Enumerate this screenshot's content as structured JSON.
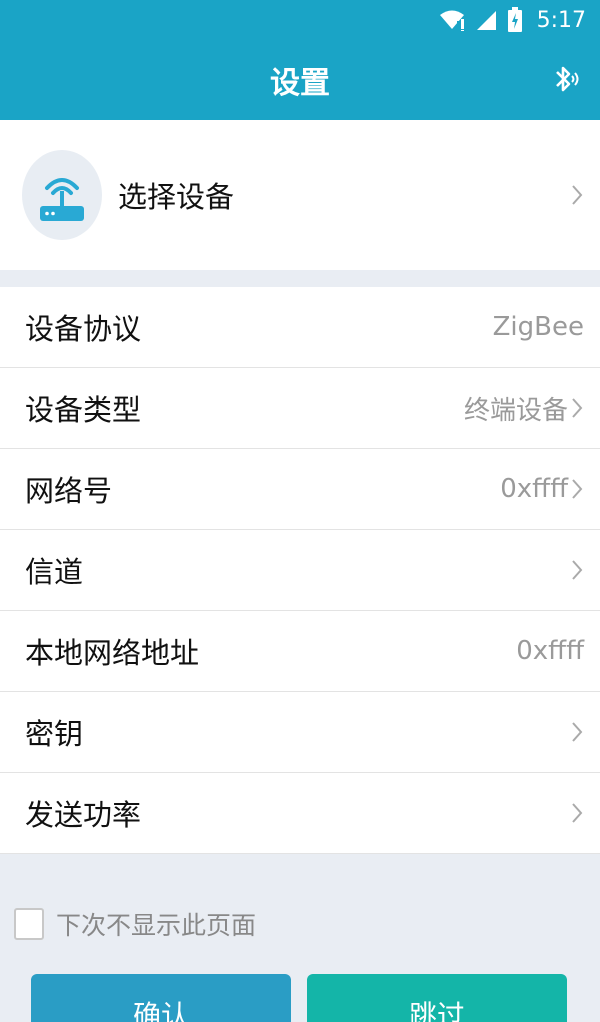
{
  "status_bar": {
    "time": "5:17",
    "icons": [
      "wifi-icon",
      "signal-icon",
      "battery-icon"
    ]
  },
  "app_bar": {
    "title": "设置",
    "action_icon": "bluetooth-icon"
  },
  "device": {
    "label": "选择设备",
    "icon": "router-icon",
    "icon_color": "#29a9d4"
  },
  "settings": [
    {
      "label": "设备协议",
      "value": "ZigBee",
      "chevron": false
    },
    {
      "label": "设备类型",
      "value": "终端设备",
      "chevron": true
    },
    {
      "label": "网络号",
      "value": "0xffff",
      "chevron": true
    },
    {
      "label": "信道",
      "value": "",
      "chevron": true
    },
    {
      "label": "本地网络地址",
      "value": "0xffff",
      "chevron": false
    },
    {
      "label": "密钥",
      "value": "",
      "chevron": true
    },
    {
      "label": "发送功率",
      "value": "",
      "chevron": true
    }
  ],
  "footer": {
    "checkbox_label": "下次不显示此页面",
    "checkbox_checked": false,
    "confirm_label": "确认",
    "skip_label": "跳过"
  },
  "colors": {
    "primary": "#1aa4c6",
    "confirm": "#2a9dc5",
    "skip": "#14b5a8",
    "background": "#e9edf3"
  }
}
